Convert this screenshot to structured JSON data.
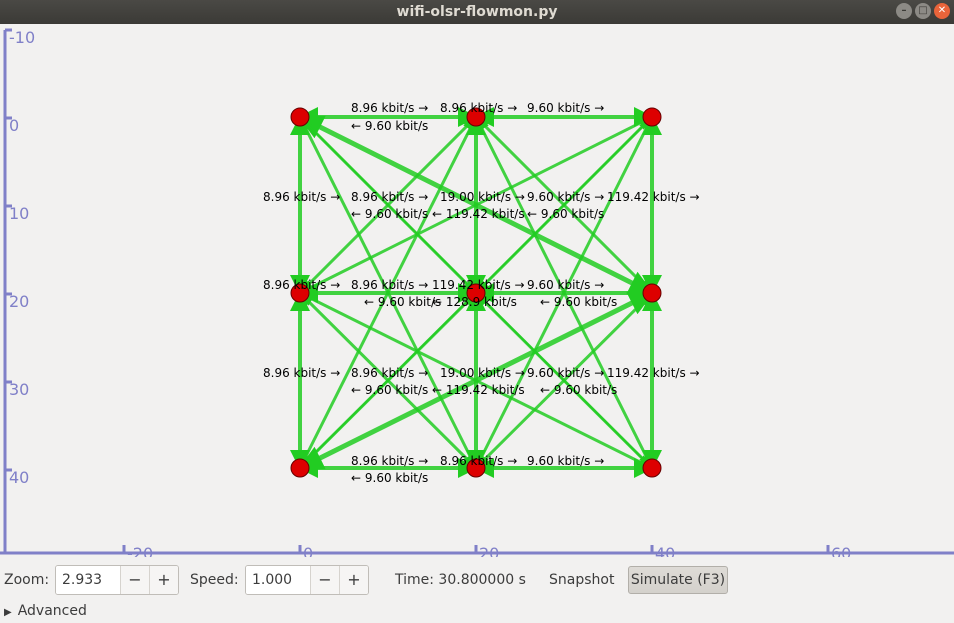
{
  "window": {
    "title": "wifi-olsr-flowmon.py",
    "buttons": [
      "–",
      "□",
      "✕"
    ]
  },
  "colors": {
    "axis": "#8080c8",
    "link": "#22cc22",
    "node_fill": "#dd0000",
    "node_stroke": "#660000"
  },
  "axes": {
    "y_ticks": [
      "-10",
      "0",
      "10",
      "20",
      "30",
      "40"
    ],
    "x_ticks": [
      "-20",
      "0",
      "20",
      "40",
      "60"
    ]
  },
  "link_labels": [
    {
      "text": "8.96 kbit/s →"
    },
    {
      "text": "← 9.60 kbit/s"
    },
    {
      "text": "8.96 kbit/s →"
    },
    {
      "text": "9.60 kbit/s →"
    },
    {
      "text": "8.96 kbit/s →"
    },
    {
      "text": "8.96 kbit/s →"
    },
    {
      "text": "19.00 kbit/s →"
    },
    {
      "text": "9.60 kbit/s →"
    },
    {
      "text": "119.42 kbit/s →"
    },
    {
      "text": "← 9.60 kbit/s"
    },
    {
      "text": "← 119.42 kbit/s"
    },
    {
      "text": "← 9.60 kbit/s"
    },
    {
      "text": "8.96 kbit/s →"
    },
    {
      "text": "8.96 kbit/s →"
    },
    {
      "text": "119.42 kbit/s →"
    },
    {
      "text": "9.60 kbit/s →"
    },
    {
      "text": "← 9.60 kbit/s"
    },
    {
      "text": "← 128.9 kbit/s"
    },
    {
      "text": "← 9.60 kbit/s"
    },
    {
      "text": "8.96 kbit/s →"
    },
    {
      "text": "8.96 kbit/s →"
    },
    {
      "text": "19.00 kbit/s →"
    },
    {
      "text": "9.60 kbit/s →"
    },
    {
      "text": "119.42 kbit/s →"
    },
    {
      "text": "← 9.60 kbit/s"
    },
    {
      "text": "← 119.42 kbit/s"
    },
    {
      "text": "← 9.60 kbit/s"
    },
    {
      "text": "8.96 kbit/s →"
    },
    {
      "text": "8.96 kbit/s →"
    },
    {
      "text": "9.60 kbit/s →"
    },
    {
      "text": "← 9.60 kbit/s"
    }
  ],
  "controls": {
    "zoom_label": "Zoom:",
    "zoom_value": "2.933",
    "speed_label": "Speed:",
    "speed_value": "1.000",
    "minus": "−",
    "plus": "+",
    "time_text": "Time: 30.800000 s",
    "snapshot_label": "Snapshot",
    "simulate_label": "Simulate (F3)",
    "advanced_label": "Advanced"
  }
}
